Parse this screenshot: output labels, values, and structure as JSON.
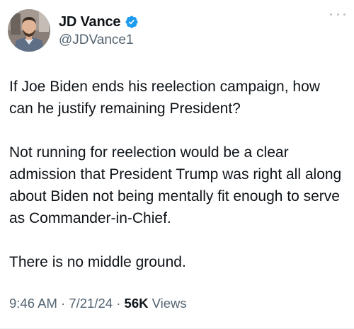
{
  "author": {
    "display_name": "JD Vance",
    "handle": "@JDVance1",
    "verified": true,
    "verified_color": "#1d9bf0"
  },
  "menu_icon": "more-horizontal-icon",
  "tweet": {
    "paragraphs": [
      "If Joe Biden ends his reelection campaign, how can he justify remaining President?",
      "Not running for reelection would be a clear admission that President Trump was right all along about Biden not being mentally fit enough to serve as Commander-in-Chief.",
      "There is no middle ground."
    ]
  },
  "meta": {
    "time": "9:46 AM",
    "separator": "·",
    "date": "7/21/24",
    "views_count": "56K",
    "views_label": "Views"
  },
  "colors": {
    "text": "#0f1419",
    "secondary": "#536471",
    "verified": "#1d9bf0"
  }
}
